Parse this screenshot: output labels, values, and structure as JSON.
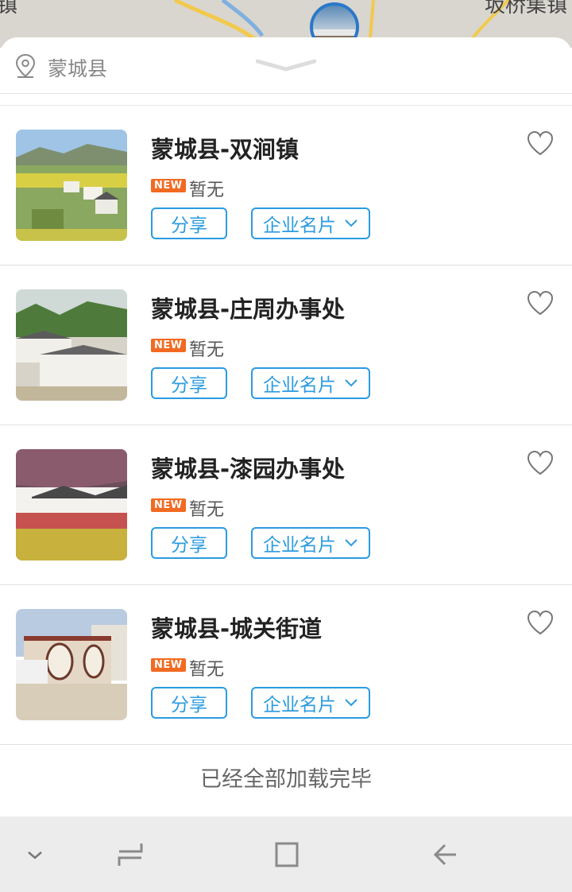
{
  "map": {
    "label_left": "镇",
    "label_right": "坂桥集镇"
  },
  "header": {
    "location": "蒙城县"
  },
  "items": [
    {
      "title": "蒙城县-双涧镇",
      "badge": "NEW",
      "status": "暂无",
      "share_label": "分享",
      "card_label": "企业名片"
    },
    {
      "title": "蒙城县-庄周办事处",
      "badge": "NEW",
      "status": "暂无",
      "share_label": "分享",
      "card_label": "企业名片"
    },
    {
      "title": "蒙城县-漆园办事处",
      "badge": "NEW",
      "status": "暂无",
      "share_label": "分享",
      "card_label": "企业名片"
    },
    {
      "title": "蒙城县-城关街道",
      "badge": "NEW",
      "status": "暂无",
      "share_label": "分享",
      "card_label": "企业名片"
    }
  ],
  "footer": {
    "end_text": "已经全部加载完毕"
  },
  "colors": {
    "accent": "#2b9be0",
    "badge": "#f26a21",
    "text": "#222222"
  },
  "icons": [
    "location-pin-icon",
    "chevron-down-icon",
    "heart-icon",
    "nav-hide-icon",
    "nav-recent-icon",
    "nav-home-icon",
    "nav-back-icon"
  ]
}
